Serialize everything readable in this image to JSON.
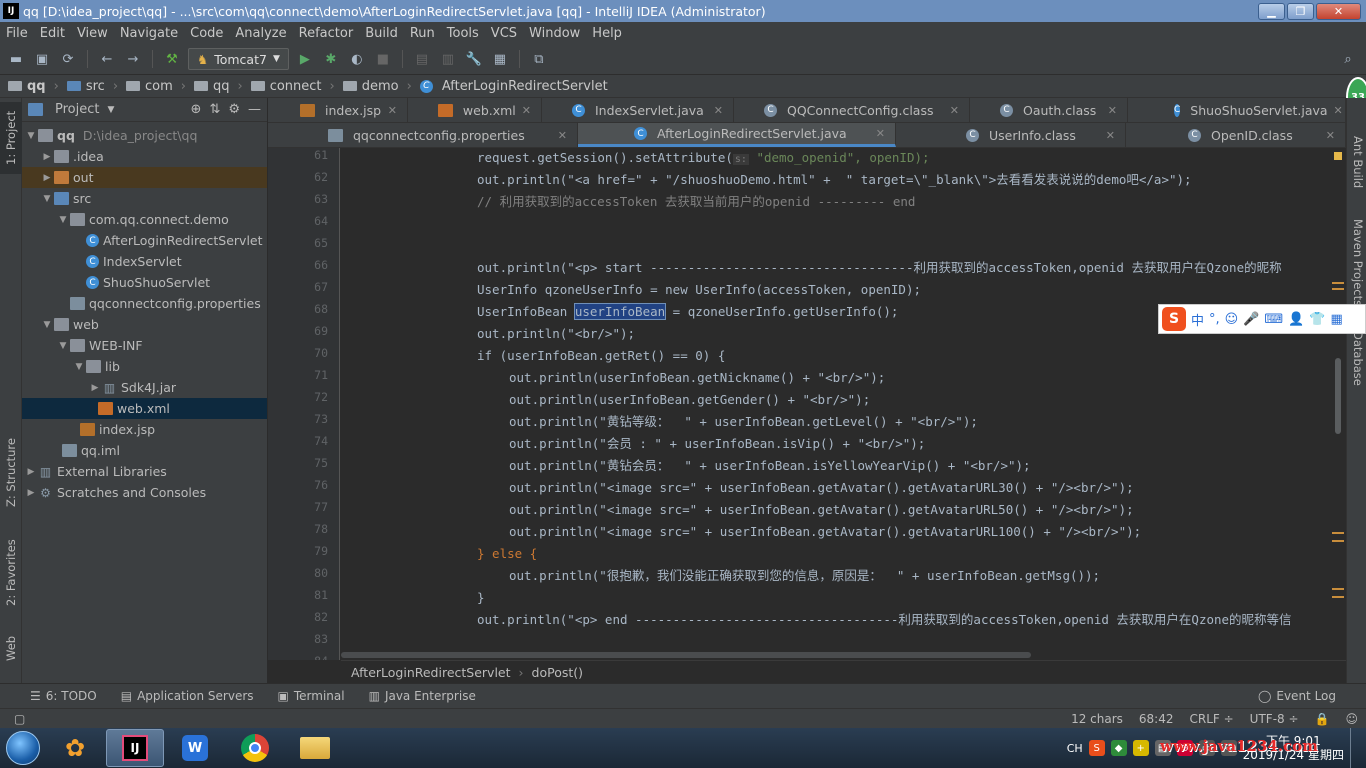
{
  "window": {
    "title": "qq [D:\\idea_project\\qq] - ...\\src\\com\\qq\\connect\\demo\\AfterLoginRedirectServlet.java [qq] - IntelliJ IDEA (Administrator)"
  },
  "menu": [
    "File",
    "Edit",
    "View",
    "Navigate",
    "Code",
    "Analyze",
    "Refactor",
    "Build",
    "Run",
    "Tools",
    "VCS",
    "Window",
    "Help"
  ],
  "toolbar": {
    "run_config": "Tomcat7"
  },
  "nav": [
    "qq",
    "src",
    "com",
    "qq",
    "connect",
    "demo",
    "AfterLoginRedirectServlet"
  ],
  "project": {
    "header": "Project",
    "tree": [
      {
        "label": "qq",
        "extra": "D:\\idea_project\\qq"
      },
      {
        "label": ".idea"
      },
      {
        "label": "out"
      },
      {
        "label": "src"
      },
      {
        "label": "com.qq.connect.demo"
      },
      {
        "label": "AfterLoginRedirectServlet"
      },
      {
        "label": "IndexServlet"
      },
      {
        "label": "ShuoShuoServlet"
      },
      {
        "label": "qqconnectconfig.properties"
      },
      {
        "label": "web"
      },
      {
        "label": "WEB-INF"
      },
      {
        "label": "lib"
      },
      {
        "label": "Sdk4J.jar"
      },
      {
        "label": "web.xml"
      },
      {
        "label": "index.jsp"
      },
      {
        "label": "qq.iml"
      },
      {
        "label": "External Libraries"
      },
      {
        "label": "Scratches and Consoles"
      }
    ]
  },
  "left_tabs": {
    "project": "1: Project",
    "structure": "Z: Structure",
    "favorites": "2: Favorites",
    "web": "Web"
  },
  "right_tabs": {
    "ant": "Ant Build",
    "maven": "Maven Projects",
    "db": "Database",
    "badge": "33"
  },
  "tabs_row1": [
    "index.jsp",
    "web.xml",
    "IndexServlet.java",
    "QQConnectConfig.class",
    "Oauth.class",
    "ShuoShuoServlet.java"
  ],
  "tabs_row2": [
    "qqconnectconfig.properties",
    "AfterLoginRedirectServlet.java",
    "UserInfo.class",
    "OpenID.class"
  ],
  "gutter": [
    "61",
    "62",
    "63",
    "64",
    "65",
    "66",
    "67",
    "68",
    "69",
    "70",
    "71",
    "72",
    "73",
    "74",
    "75",
    "76",
    "77",
    "78",
    "79",
    "80",
    "81",
    "82",
    "83",
    "84"
  ],
  "code": {
    "l61a": "request.getSession().setAttribute(",
    "l61p": "s:",
    "l61b": " \"demo_openid\", openID);",
    "l62": "out.println(\"<a href=\" + \"/shuoshuoDemo.html\" +  \" target=\\\"_blank\\\">去看看发表说说的demo吧</a>\");",
    "l63": "// 利用获取到的accessToken 去获取当前用户的openid --------- end",
    "l66": "out.println(\"<p> start -----------------------------------利用获取到的accessToken,openid 去获取用户在Qzone的昵称",
    "l67": "UserInfo qzoneUserInfo = new UserInfo(accessToken, openID);",
    "l68a": "UserInfoBean ",
    "l68b": "userInfoBean",
    "l68c": " = qzoneUserInfo.getUserInfo();",
    "l69": "out.println(\"<br/>\");",
    "l70": "if (userInfoBean.getRet() == 0) {",
    "l71": "out.println(userInfoBean.getNickname() + \"<br/>\");",
    "l72": "out.println(userInfoBean.getGender() + \"<br/>\");",
    "l73": "out.println(\"黄钻等级：  \" + userInfoBean.getLevel() + \"<br/>\");",
    "l74": "out.println(\"会员 : \" + userInfoBean.isVip() + \"<br/>\");",
    "l75": "out.println(\"黄钻会员：  \" + userInfoBean.isYellowYearVip() + \"<br/>\");",
    "l76": "out.println(\"<image src=\" + userInfoBean.getAvatar().getAvatarURL30() + \"/><br/>\");",
    "l77": "out.println(\"<image src=\" + userInfoBean.getAvatar().getAvatarURL50() + \"/><br/>\");",
    "l78": "out.println(\"<image src=\" + userInfoBean.getAvatar().getAvatarURL100() + \"/><br/>\");",
    "l79": "} else {",
    "l80": "out.println(\"很抱歉，我们没能正确获取到您的信息，原因是：  \" + userInfoBean.getMsg());",
    "l81": "}",
    "l82": "out.println(\"<p> end -----------------------------------利用获取到的accessToken,openid 去获取用户在Qzone的昵称等信"
  },
  "breadcrumbs": [
    "AfterLoginRedirectServlet",
    "doPost()"
  ],
  "toolwindows": [
    "6: TODO",
    "Application Servers",
    "Terminal",
    "Java Enterprise",
    "Event Log"
  ],
  "status": {
    "chars": "12 chars",
    "pos": "68:42",
    "crlf": "CRLF",
    "enc": "UTF-8"
  },
  "ime": {
    "lang": "中"
  },
  "taskbar": {
    "lang": "CH",
    "time": "下午 9:01",
    "date": "2019/1/24 星期四",
    "watermark": "www.java1234.com"
  }
}
